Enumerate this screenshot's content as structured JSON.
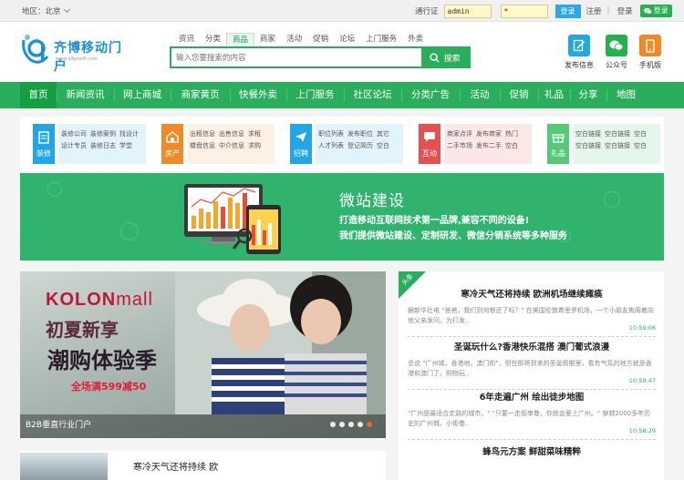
{
  "topbar": {
    "region_label": "地区：北京",
    "passport_label": "通行证",
    "username_value": "admin",
    "password_value": "*",
    "login_btn": "登录",
    "register": "注册",
    "logout": "登录",
    "wx_login": "登录"
  },
  "logo": {
    "name": "齐博移动门户",
    "sub": "www.qibosoft.com"
  },
  "search": {
    "tabs": [
      "资讯",
      "分类",
      "商品",
      "商家",
      "活动",
      "促销",
      "论坛",
      "上门服务",
      "外卖"
    ],
    "active_tab": "商品",
    "placeholder": "输入您要搜索的内容",
    "button": "搜索"
  },
  "quick": [
    {
      "label": "发布信息",
      "color": "#23a6e6"
    },
    {
      "label": "公众号",
      "color": "#22b14c"
    },
    {
      "label": "手机版",
      "color": "#f08a24"
    }
  ],
  "nav": [
    "首页",
    "新闻资讯",
    "网上商城",
    "商家黄页",
    "快餐外卖",
    "上门服务",
    "社区论坛",
    "分类广告",
    "活动",
    "促销",
    "礼品",
    "分享",
    "地图"
  ],
  "categories": [
    {
      "name": "装修",
      "color": "#23a6e6",
      "bg": "#e3f3fb",
      "links": [
        "装修公司",
        "装修案例",
        "找设计",
        "设计专员",
        "装修日志",
        "学堂"
      ]
    },
    {
      "name": "房产",
      "color": "#f08a24",
      "bg": "#fdf0e4",
      "links": [
        "出租信息",
        "出售信息",
        "求租",
        "楼盘信息",
        "中介信息",
        "求购"
      ]
    },
    {
      "name": "招聘",
      "color": "#23a6e6",
      "bg": "#e3f3fb",
      "links": [
        "职位列表",
        "发布职位",
        "其它",
        "人才列表",
        "登记简历",
        "空白"
      ]
    },
    {
      "name": "互动",
      "color": "#e85050",
      "bg": "#fce7e7",
      "links": [
        "商家点评",
        "发布商家",
        "热门",
        "二手市场",
        "发布二手",
        "空白"
      ]
    },
    {
      "name": "礼品",
      "color": "#55c978",
      "bg": "#e5f7ea",
      "links": [
        "空白链接",
        "空白链接",
        "空白",
        "空白链接",
        "空白链接",
        "空白"
      ]
    }
  ],
  "banner": {
    "title": "微站建设",
    "line1": "打造移动互联网技术第一品牌,兼容不同的设备!",
    "line2": "我们提供微站建设、定制研发、微信分销系统等多种服务"
  },
  "slider": {
    "brand": "KOLON",
    "brand_tail": "mall",
    "headline1": "初夏新享",
    "headline2": "潮购体验季",
    "promo": "全场满599减50",
    "caption": "B2B垂直行业门户",
    "slide_count": 5,
    "active_slide": 5
  },
  "news": {
    "badge": "头条",
    "items": [
      {
        "title": "寒冷天气还将持续 欧洲机场继续瘫痪",
        "desc": "据新华社电 \"爸爸，我们到何根还了吗？\" 在美国伦敦希思罗机场，一个小朋友焦阁着向他父亲发问。为打发..",
        "time": "10:59:06"
      },
      {
        "title": "圣诞玩什么?香港快乐混搭 澳门葡式浪漫",
        "desc": "总说 \"广州城，香港地，澳门街\"，但在即将到来的圣诞假期里，看有气氛的地方就是香港和澳门了。购物玩..",
        "time": "10:59:47"
      },
      {
        "title": "6年走遍广州 绘出徒步地图",
        "desc": "\"广州是最适合走路的城市。\" \"只要一走街串巷，你就会爱上广州。\" 穿越2000多年历史的广州城，小街巷..",
        "time": "10:58:29"
      },
      {
        "title": "蜂鸟元方案 鲜甜菜味精粹",
        "desc": "",
        "time": ""
      }
    ]
  },
  "bottom_card": {
    "title": "寒冷天气还将持续 欧"
  }
}
